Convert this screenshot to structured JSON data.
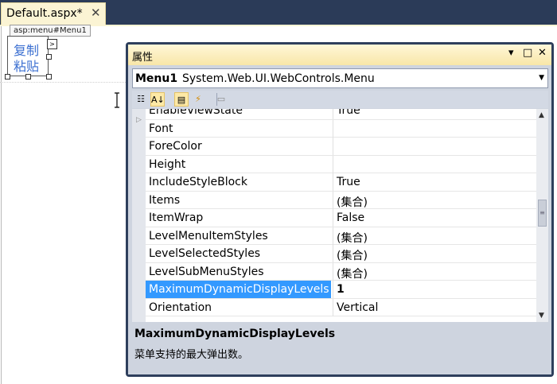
{
  "document": {
    "tab_title": "Default.aspx*",
    "close_glyph": "✕"
  },
  "designer": {
    "control_tag": "asp:menu#Menu1",
    "menu_items": [
      "复制",
      "粘贴"
    ],
    "smart_tag_glyph": ">"
  },
  "properties": {
    "title": "属性",
    "title_buttons": [
      "▾",
      "□",
      "✕"
    ],
    "object_name": "Menu1",
    "object_type": "System.Web.UI.WebControls.Menu",
    "toolbar": [
      {
        "name": "categorized-icon",
        "glyph": "☷",
        "active": false
      },
      {
        "name": "alphabetical-icon",
        "glyph": "A↓",
        "active": true
      },
      {
        "name": "properties-icon",
        "glyph": "▤",
        "active": true
      },
      {
        "name": "events-icon",
        "glyph": "⚡",
        "active": false
      },
      {
        "name": "property-pages-icon",
        "glyph": "▭",
        "active": false
      }
    ],
    "rows": [
      {
        "name": "EnableViewState",
        "value": "True",
        "expandable": false,
        "selected": false
      },
      {
        "name": "Font",
        "value": "",
        "expandable": true,
        "selected": false
      },
      {
        "name": "ForeColor",
        "value": "",
        "expandable": false,
        "selected": false
      },
      {
        "name": "Height",
        "value": "",
        "expandable": false,
        "selected": false
      },
      {
        "name": "IncludeStyleBlock",
        "value": "True",
        "expandable": false,
        "selected": false
      },
      {
        "name": "Items",
        "value": "(集合)",
        "expandable": false,
        "selected": false
      },
      {
        "name": "ItemWrap",
        "value": "False",
        "expandable": false,
        "selected": false
      },
      {
        "name": "LevelMenuItemStyles",
        "value": "(集合)",
        "expandable": false,
        "selected": false
      },
      {
        "name": "LevelSelectedStyles",
        "value": "(集合)",
        "expandable": false,
        "selected": false
      },
      {
        "name": "LevelSubMenuStyles",
        "value": "(集合)",
        "expandable": false,
        "selected": false
      },
      {
        "name": "MaximumDynamicDisplayLevels",
        "value": "1",
        "expandable": false,
        "selected": true
      },
      {
        "name": "Orientation",
        "value": "Vertical",
        "expandable": false,
        "selected": false
      }
    ],
    "description": {
      "title": "MaximumDynamicDisplayLevels",
      "text": "菜单支持的最大弹出数。"
    }
  }
}
